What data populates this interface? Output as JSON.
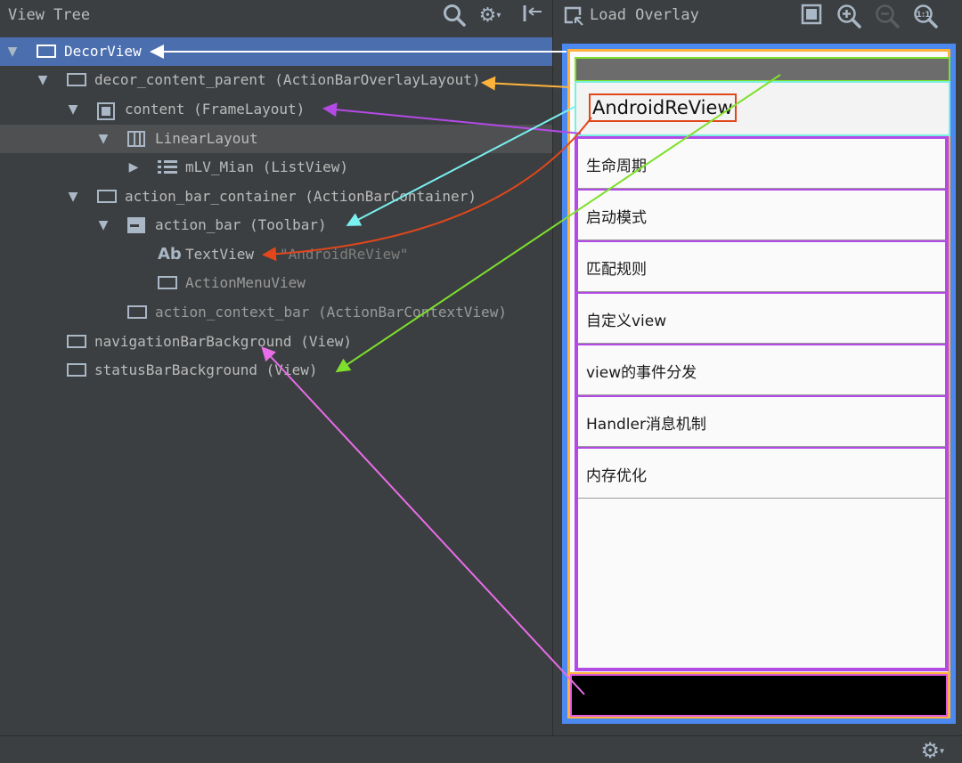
{
  "left_panel": {
    "title": "View Tree",
    "icons": [
      "search-icon",
      "gear-icon",
      "collapse-icon"
    ]
  },
  "right_panel": {
    "load_overlay_label": "Load Overlay",
    "icons": [
      "fit-screen-icon",
      "zoom-in-icon",
      "zoom-out-icon",
      "actual-size-icon"
    ]
  },
  "tree": [
    {
      "name": "DecorView",
      "type": "",
      "expanded": true,
      "selected": true
    },
    {
      "name": "decor_content_parent",
      "type": "(ActionBarOverlayLayout)",
      "expanded": true
    },
    {
      "name": "content",
      "type": "(FrameLayout)",
      "expanded": true
    },
    {
      "name": "LinearLayout",
      "type": "",
      "expanded": true,
      "hover": true
    },
    {
      "name": "mLV_Mian",
      "type": "(ListView)",
      "expanded": false
    },
    {
      "name": "action_bar_container",
      "type": "(ActionBarContainer)",
      "expanded": true
    },
    {
      "name": "action_bar",
      "type": "(Toolbar)",
      "expanded": true
    },
    {
      "name": "TextView",
      "type": "- \"AndroidReView\""
    },
    {
      "name": "ActionMenuView",
      "type": ""
    },
    {
      "name": "action_context_bar",
      "type": "(ActionBarContextView)"
    },
    {
      "name": "navigationBarBackground",
      "type": "(View)"
    },
    {
      "name": "statusBarBackground",
      "type": "(View)"
    }
  ],
  "device": {
    "app_title": "AndroidReView",
    "list_items": [
      "生命周期",
      "启动模式",
      "匹配规则",
      "自定义view",
      "view的事件分发",
      "Handler消息机制",
      "内存优化"
    ]
  },
  "colors": {
    "selection": "#4b6eaf",
    "decor_view": "#4b88f0",
    "decor_content_parent": "#ffb33c",
    "content": "#b44ae6",
    "action_bar": "#7af0e0",
    "text_view": "#e2471b",
    "status_bar": "#7ee02c",
    "navigation_bar": "#e05ae0"
  }
}
